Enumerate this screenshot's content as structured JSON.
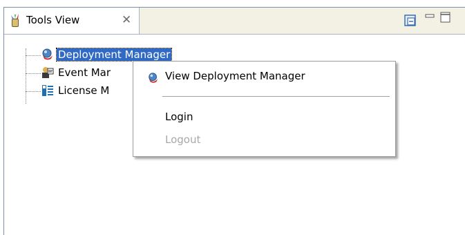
{
  "view": {
    "title": "Tools View",
    "icons": {
      "view": "tools-view-icon",
      "close": "close-icon",
      "collapse": "collapse-all-icon",
      "minimize": "minimize-icon",
      "maximize": "maximize-icon"
    }
  },
  "tree": {
    "items": [
      {
        "label": "Deployment Manager",
        "icon": "deployment-manager-icon",
        "selected": true
      },
      {
        "label": "Event Mar",
        "icon": "event-manager-icon",
        "selected": false
      },
      {
        "label": "License M",
        "icon": "license-manager-icon",
        "selected": false
      }
    ]
  },
  "context_menu": {
    "items": [
      {
        "label": "View Deployment Manager",
        "icon": "deployment-manager-icon",
        "enabled": true
      },
      {
        "label": "Login",
        "enabled": true
      },
      {
        "label": "Logout",
        "enabled": false
      }
    ]
  },
  "colors": {
    "selection": "#316ac5",
    "disabled_text": "#a8a8a8",
    "tabbar_bg": "#f3f1e4"
  }
}
